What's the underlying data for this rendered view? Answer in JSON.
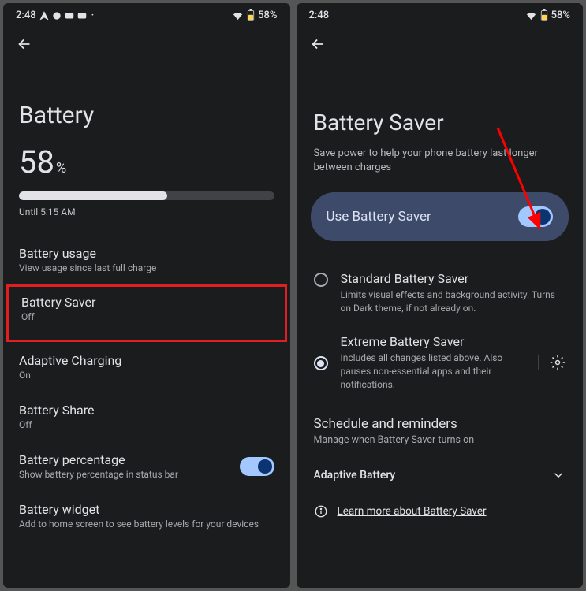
{
  "left": {
    "status": {
      "time": "2:48",
      "battery": "58%"
    },
    "title": "Battery",
    "percentage_value": "58",
    "percentage_sign": "%",
    "until": "Until 5:15 AM",
    "items": [
      {
        "title": "Battery usage",
        "sub": "View usage since last full charge"
      },
      {
        "title": "Battery Saver",
        "sub": "Off"
      },
      {
        "title": "Adaptive Charging",
        "sub": "On"
      },
      {
        "title": "Battery Share",
        "sub": "Off"
      },
      {
        "title": "Battery percentage",
        "sub": "Show battery percentage in status bar"
      },
      {
        "title": "Battery widget",
        "sub": "Add to home screen to see battery levels for your devices"
      }
    ]
  },
  "right": {
    "status": {
      "time": "2:48",
      "battery": "58%"
    },
    "title": "Battery Saver",
    "subtitle": "Save power to help your phone battery last longer between charges",
    "pill": {
      "label": "Use Battery Saver"
    },
    "radios": [
      {
        "title": "Standard Battery Saver",
        "sub": "Limits visual effects and background activity. Turns on Dark theme, if not already on."
      },
      {
        "title": "Extreme Battery Saver",
        "sub": "Includes all changes listed above. Also pauses non-essential apps and their notifications."
      }
    ],
    "schedule": {
      "title": "Schedule and reminders",
      "sub": "Manage when Battery Saver turns on"
    },
    "adaptive_label": "Adaptive Battery",
    "learn_more": "Learn more about Battery Saver"
  }
}
